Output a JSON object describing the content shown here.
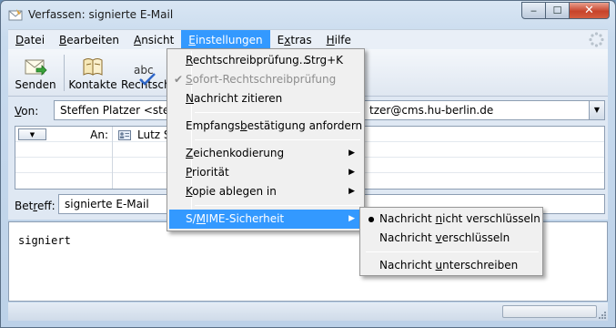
{
  "window": {
    "title": "Verfassen: signierte E-Mail",
    "minimize_glyph": "‒",
    "maximize_glyph": "☐",
    "close_glyph": "✕"
  },
  "menubar": {
    "items": [
      {
        "label": "Datei",
        "key": "D"
      },
      {
        "label": "Bearbeiten",
        "key": "B"
      },
      {
        "label": "Ansicht",
        "key": "A"
      },
      {
        "label": "Einstellungen",
        "key": "E",
        "active": true
      },
      {
        "label": "Extras",
        "key": "x"
      },
      {
        "label": "Hilfe",
        "key": "H"
      }
    ]
  },
  "toolbar": {
    "send_label": "Senden",
    "contacts_label": "Kontakte",
    "spelling_label": "Rechtschreibung",
    "spelling_icon_text": "abc"
  },
  "compose": {
    "from_label": "Von:",
    "from_value_start": "Steffen Platzer <steffen.",
    "from_value_end": "tzer@cms.hu-berlin.de",
    "recipient_type": "An:",
    "recipient_value": "Lutz S",
    "subject_label": "Betreff:",
    "subject_value": "signierte E-Mail",
    "body_text": "signiert"
  },
  "settings_menu": {
    "items": [
      {
        "label": "Rechtschreibprüfung...",
        "shortcut": "Strg+K"
      },
      {
        "label": "Sofort-Rechtschreibprüfung",
        "disabled": true,
        "checked": true
      },
      {
        "label": "Nachricht zitieren"
      },
      {
        "label": "Empfangsbestätigung anfordern"
      },
      {
        "label": "Zeichenkodierung",
        "submenu": true
      },
      {
        "label": "Priorität",
        "submenu": true
      },
      {
        "label": "Kopie ablegen in",
        "submenu": true
      },
      {
        "label": "S/MIME-Sicherheit",
        "submenu": true,
        "highlighted": true
      }
    ],
    "check_glyph": "✔",
    "arrow_glyph": "▶"
  },
  "smime_submenu": {
    "items": [
      {
        "label": "Nachricht nicht verschlüsseln",
        "selected": true
      },
      {
        "label": "Nachricht verschlüsseln"
      },
      {
        "label": "Nachricht unterschreiben"
      }
    ],
    "radio_glyph": "●"
  },
  "colors": {
    "menu_highlight": "#3399ff",
    "window_frame": "#c9dbee",
    "close_button": "#c7432b"
  }
}
